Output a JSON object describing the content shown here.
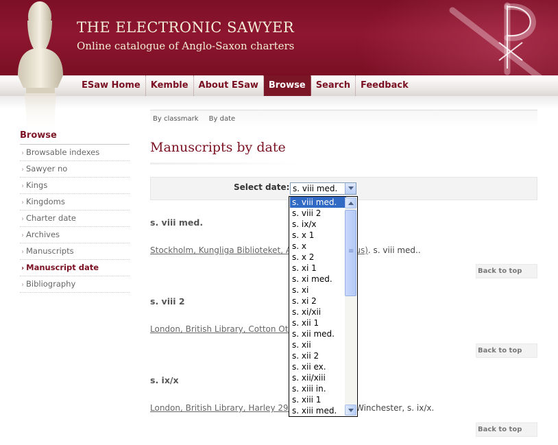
{
  "header": {
    "title": "THE ELECTRONIC SAWYER",
    "subtitle": "Online catalogue of Anglo-Saxon charters"
  },
  "nav": {
    "items": [
      {
        "label": "ESaw Home"
      },
      {
        "label": "Kemble"
      },
      {
        "label": "About ESaw"
      },
      {
        "label": "Browse",
        "active": true
      },
      {
        "label": "Search"
      },
      {
        "label": "Feedback"
      }
    ]
  },
  "subnav": {
    "items": [
      {
        "label": "By classmark"
      },
      {
        "label": "By date"
      }
    ]
  },
  "sidebar": {
    "heading": "Browse",
    "items": [
      {
        "label": "Browsable indexes"
      },
      {
        "label": "Sawyer no"
      },
      {
        "label": "Kings"
      },
      {
        "label": "Kingdoms"
      },
      {
        "label": "Charter date"
      },
      {
        "label": "Archives"
      },
      {
        "label": "Manuscripts"
      },
      {
        "label": "Manuscript date",
        "current": true
      },
      {
        "label": "Bibliography"
      }
    ]
  },
  "main": {
    "title": "Manuscripts by date",
    "select_label": "Select date:",
    "select_value": "s. viii med.",
    "sections": [
      {
        "heading": "s. viii med.",
        "link": "Stockholm, Kungliga Biblioteket, A",
        "link_tail": "eus)",
        "suffix": ". s. viii med.."
      },
      {
        "heading": "s. viii 2",
        "link": "London, British Library, Cotton Oth",
        "link_tail": "",
        "suffix": ""
      },
      {
        "heading": "s. ix/x",
        "link": "London, British Library, Harley 2965",
        "link_tail": "",
        "suffix": "Winchester, s. ix/x."
      }
    ],
    "back_to_top": "Back to top"
  },
  "dropdown": {
    "options": [
      "s. viii med.",
      "s. viii 2",
      "s. ix/x",
      "s. x 1",
      "s. x",
      "s. x 2",
      "s. xi 1",
      "s. xi med.",
      "s. xi",
      "s. xi 2",
      "s. xi/xii",
      "s. xii 1",
      "s. xii med.",
      "s. xii",
      "s. xii 2",
      "s. xii ex.",
      "s. xii/xiii",
      "s. xiii in.",
      "s. xiii 1",
      "s. xiii med."
    ],
    "selected_index": 0
  },
  "colors": {
    "banner": "#8e1630",
    "accent": "#7a1022",
    "nav_active": "#7a1626",
    "highlight": "#316ac5"
  }
}
